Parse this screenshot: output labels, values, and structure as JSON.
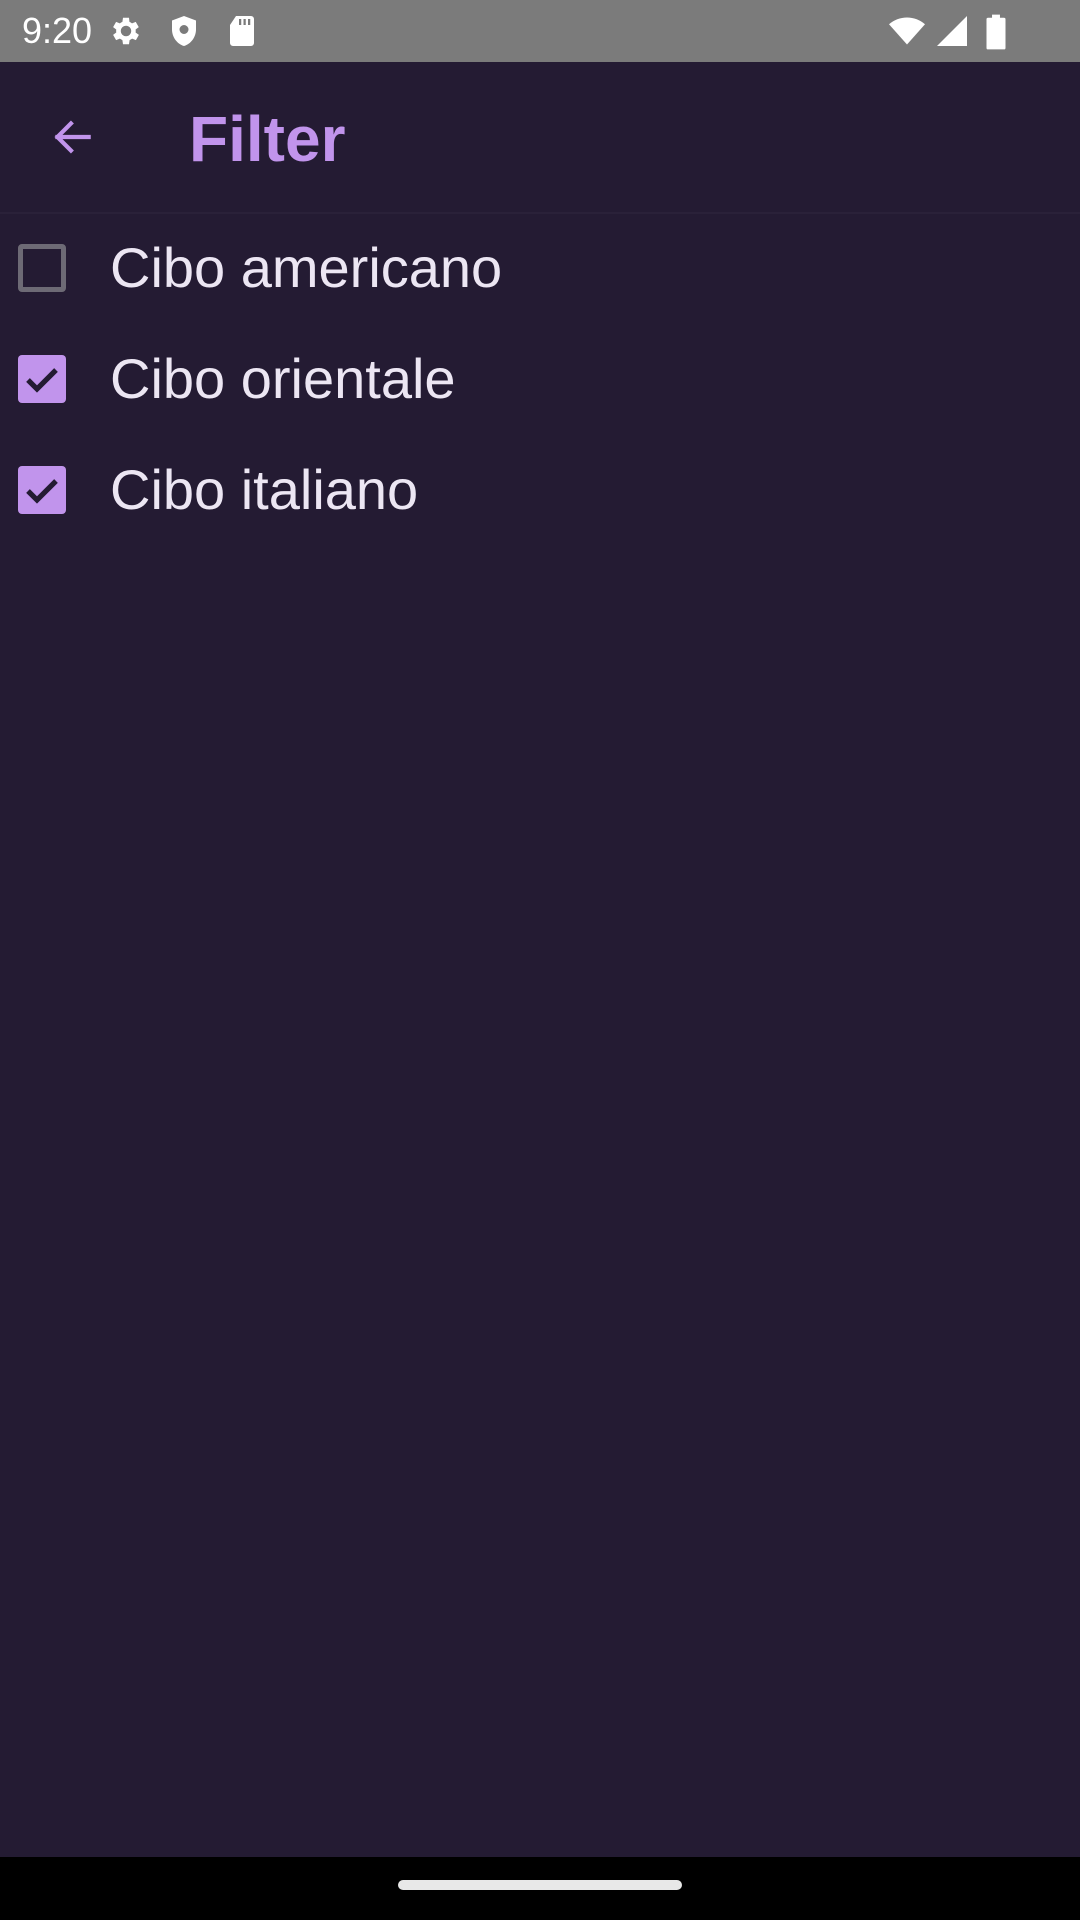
{
  "status_bar": {
    "time": "9:20",
    "left_icons": [
      "gear-icon",
      "shield-icon",
      "sd-card-icon"
    ],
    "right_icons": [
      "wifi-icon",
      "signal-icon",
      "battery-icon"
    ]
  },
  "app_bar": {
    "back_icon": "arrow-left-icon",
    "title": "Filter"
  },
  "filters": [
    {
      "label": "Cibo americano",
      "checked": false
    },
    {
      "label": "Cibo orientale",
      "checked": true
    },
    {
      "label": "Cibo italiano",
      "checked": true
    }
  ],
  "colors": {
    "background": "#241b33",
    "accent": "#c194ec",
    "status_bar": "#7b7b7b",
    "text": "#ece6f3",
    "nav_bar": "#000000"
  }
}
